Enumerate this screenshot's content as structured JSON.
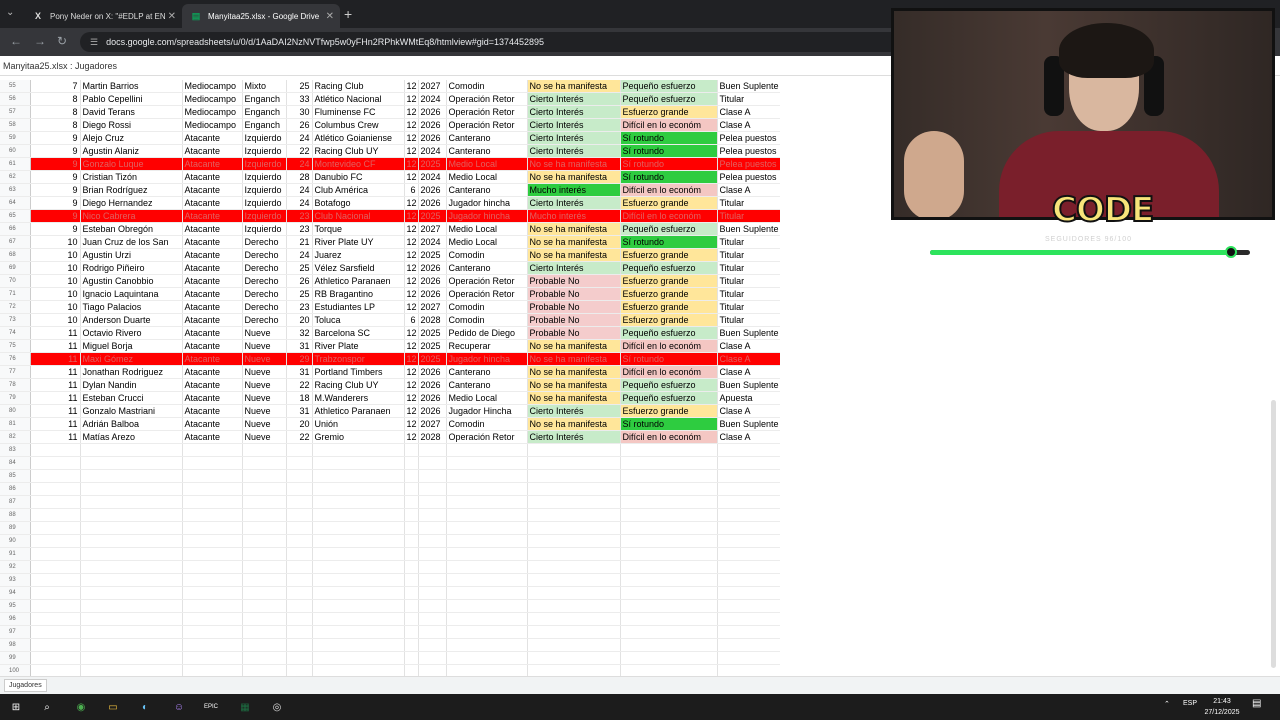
{
  "browser": {
    "tabs": [
      {
        "label": "Pony Neder on X: \"#EDLP at EN",
        "icon": "X"
      },
      {
        "label": "Manyitaa25.xlsx - Google Drive",
        "icon": "▤"
      }
    ],
    "url": "docs.google.com/spreadsheets/u/0/d/1AaDAI2NzNVTfwp5w0yFHn2RPhkWMtEq8/htmlview#gid=1374452895"
  },
  "sheet": {
    "title": "Manyitaa25.xlsx : Jugadores",
    "bottom_tab": "Jugadores",
    "rows": [
      {
        "rn": "55",
        "n": "7",
        "name": "Martin Barrios",
        "pos": "Mediocampo",
        "sub": "Mixto",
        "age": "25",
        "club": "Racing Club",
        "m": "12",
        "y": "2027",
        "type": "Comodin",
        "int": "No se ha manifesta",
        "eff": "Pequeño esfuerzo",
        "role": "Buen Suplente",
        "ic": "y",
        "ec": "gl",
        "rc": ""
      },
      {
        "rn": "56",
        "n": "8",
        "name": "Pablo Cepellini",
        "pos": "Mediocampo",
        "sub": "Enganch",
        "age": "33",
        "club": "Atlético Nacional",
        "m": "12",
        "y": "2024",
        "type": "Operación Retor",
        "int": "Cierto Interés",
        "eff": "Pequeño esfuerzo",
        "role": "Titular",
        "ic": "gl",
        "ec": "gl",
        "rc": ""
      },
      {
        "rn": "57",
        "n": "8",
        "name": "David Terans",
        "pos": "Mediocampo",
        "sub": "Enganch",
        "age": "30",
        "club": "Fluminense FC",
        "m": "12",
        "y": "2026",
        "type": "Operación Retor",
        "int": "Cierto Interés",
        "eff": "Esfuerzo grande",
        "role": "Clase A",
        "ic": "gl",
        "ec": "y",
        "rc": ""
      },
      {
        "rn": "58",
        "n": "8",
        "name": "Diego Rossi",
        "pos": "Mediocampo",
        "sub": "Enganch",
        "age": "26",
        "club": "Columbus Crew",
        "m": "12",
        "y": "2026",
        "type": "Operación Retor",
        "int": "Cierto Interés",
        "eff": "Difícil en lo económ",
        "role": "Clase A",
        "ic": "gl",
        "ec": "pk",
        "rc": ""
      },
      {
        "rn": "59",
        "n": "9",
        "name": "Alejo Cruz",
        "pos": "Atacante",
        "sub": "Izquierdo",
        "age": "24",
        "club": "Atlético Goianiense",
        "m": "12",
        "y": "2026",
        "type": "Canterano",
        "int": "Cierto Interés",
        "eff": "Sí rotundo",
        "role": "Pelea puestos",
        "ic": "gl",
        "ec": "gs",
        "rc": ""
      },
      {
        "rn": "60",
        "n": "9",
        "name": "Agustin Alaniz",
        "pos": "Atacante",
        "sub": "Izquierdo",
        "age": "22",
        "club": "Racing Club UY",
        "m": "12",
        "y": "2024",
        "type": "Canterano",
        "int": "Cierto Interés",
        "eff": "Sí rotundo",
        "role": "Pelea puestos",
        "ic": "gl",
        "ec": "gs",
        "rc": ""
      },
      {
        "rn": "61",
        "n": "9",
        "name": "Gonzalo Luque",
        "pos": "Atacante",
        "sub": "Izquierdo",
        "age": "24",
        "club": "Montevideo CF",
        "m": "12",
        "y": "2025",
        "type": "Medio Local",
        "int": "No se ha manifesta",
        "eff": "Sí rotundo",
        "role": "Pelea puestos",
        "ic": "y",
        "ec": "gs",
        "rc": "",
        "red": true
      },
      {
        "rn": "62",
        "n": "9",
        "name": "Cristian Tizón",
        "pos": "Atacante",
        "sub": "Izquierdo",
        "age": "28",
        "club": "Danubio FC",
        "m": "12",
        "y": "2024",
        "type": "Medio Local",
        "int": "No se ha manifesta",
        "eff": "Sí rotundo",
        "role": "Pelea puestos",
        "ic": "y",
        "ec": "gs",
        "rc": ""
      },
      {
        "rn": "63",
        "n": "9",
        "name": "Brian Rodríguez",
        "pos": "Atacante",
        "sub": "Izquierdo",
        "age": "24",
        "club": "Club América",
        "m": "6",
        "y": "2026",
        "type": "Canterano",
        "int": "Mucho interés",
        "eff": "Difícil en lo económ",
        "role": "Clase A",
        "ic": "gs",
        "ec": "pk",
        "rc": ""
      },
      {
        "rn": "64",
        "n": "9",
        "name": "Diego Hernandez",
        "pos": "Atacante",
        "sub": "Izquierdo",
        "age": "24",
        "club": "Botafogo",
        "m": "12",
        "y": "2026",
        "type": "Jugador hincha",
        "int": "Cierto Interés",
        "eff": "Esfuerzo grande",
        "role": "Titular",
        "ic": "gl",
        "ec": "y",
        "rc": ""
      },
      {
        "rn": "65",
        "n": "9",
        "name": "Nico Cabrera",
        "pos": "Atacante",
        "sub": "Izquierdo",
        "age": "23",
        "club": "Club Nacional",
        "m": "12",
        "y": "2025",
        "type": "Jugador hincha",
        "int": "Mucho interés",
        "eff": "Difícil en lo económ",
        "role": "Titular",
        "ic": "gs",
        "ec": "pk",
        "rc": "",
        "red": true
      },
      {
        "rn": "66",
        "n": "9",
        "name": "Esteban Obregón",
        "pos": "Atacante",
        "sub": "Izquierdo",
        "age": "23",
        "club": "Torque",
        "m": "12",
        "y": "2027",
        "type": "Medio Local",
        "int": "No se ha manifesta",
        "eff": "Pequeño esfuerzo",
        "role": "Buen Suplente",
        "ic": "y",
        "ec": "gl",
        "rc": ""
      },
      {
        "rn": "67",
        "n": "10",
        "name": "Juan Cruz de los San",
        "pos": "Atacante",
        "sub": "Derecho",
        "age": "21",
        "club": "River Plate UY",
        "m": "12",
        "y": "2024",
        "type": "Medio Local",
        "int": "No se ha manifesta",
        "eff": "Sí rotundo",
        "role": "Titular",
        "ic": "y",
        "ec": "gs",
        "rc": ""
      },
      {
        "rn": "68",
        "n": "10",
        "name": "Agustin Urzi",
        "pos": "Atacante",
        "sub": "Derecho",
        "age": "24",
        "club": "Juarez",
        "m": "12",
        "y": "2025",
        "type": "Comodin",
        "int": "No se ha manifesta",
        "eff": "Esfuerzo grande",
        "role": "Titular",
        "ic": "y",
        "ec": "y",
        "rc": ""
      },
      {
        "rn": "69",
        "n": "10",
        "name": "Rodrigo Piñeiro",
        "pos": "Atacante",
        "sub": "Derecho",
        "age": "25",
        "club": "Vélez Sarsfield",
        "m": "12",
        "y": "2026",
        "type": "Canterano",
        "int": "Cierto Interés",
        "eff": "Pequeño esfuerzo",
        "role": "Titular",
        "ic": "gl",
        "ec": "gl",
        "rc": ""
      },
      {
        "rn": "70",
        "n": "10",
        "name": "Agustin Canobbio",
        "pos": "Atacante",
        "sub": "Derecho",
        "age": "26",
        "club": "Athletico Paranaen",
        "m": "12",
        "y": "2026",
        "type": "Operación Retor",
        "int": "Probable No",
        "eff": "Esfuerzo grande",
        "role": "Titular",
        "ic": "rp",
        "ec": "y",
        "rc": ""
      },
      {
        "rn": "71",
        "n": "10",
        "name": "Ignacio Laquintana",
        "pos": "Atacante",
        "sub": "Derecho",
        "age": "25",
        "club": "RB Bragantino",
        "m": "12",
        "y": "2026",
        "type": "Operación Retor",
        "int": "Probable No",
        "eff": "Esfuerzo grande",
        "role": "Titular",
        "ic": "rp",
        "ec": "y",
        "rc": ""
      },
      {
        "rn": "72",
        "n": "10",
        "name": "Tiago Palacios",
        "pos": "Atacante",
        "sub": "Derecho",
        "age": "23",
        "club": "Estudiantes LP",
        "m": "12",
        "y": "2027",
        "type": "Comodin",
        "int": "Probable No",
        "eff": "Esfuerzo grande",
        "role": "Titular",
        "ic": "rp",
        "ec": "y",
        "rc": ""
      },
      {
        "rn": "73",
        "n": "10",
        "name": "Anderson Duarte",
        "pos": "Atacante",
        "sub": "Derecho",
        "age": "20",
        "club": "Toluca",
        "m": "6",
        "y": "2028",
        "type": "Comodin",
        "int": "Probable No",
        "eff": "Esfuerzo grande",
        "role": "Titular",
        "ic": "rp",
        "ec": "y",
        "rc": ""
      },
      {
        "rn": "74",
        "n": "11",
        "name": "Octavio Rivero",
        "pos": "Atacante",
        "sub": "Nueve",
        "age": "32",
        "club": "Barcelona SC",
        "m": "12",
        "y": "2025",
        "type": "Pedido de Diego",
        "int": "Probable No",
        "eff": "Pequeño esfuerzo",
        "role": "Buen Suplente",
        "ic": "rp",
        "ec": "gl",
        "rc": ""
      },
      {
        "rn": "75",
        "n": "11",
        "name": "Miguel Borja",
        "pos": "Atacante",
        "sub": "Nueve",
        "age": "31",
        "club": "River Plate",
        "m": "12",
        "y": "2025",
        "type": "Recuperar",
        "int": "No se ha manifesta",
        "eff": "Difícil en lo económ",
        "role": "Clase A",
        "ic": "y",
        "ec": "pk",
        "rc": ""
      },
      {
        "rn": "76",
        "n": "11",
        "name": "Maxi Gómez",
        "pos": "Atacante",
        "sub": "Nueve",
        "age": "29",
        "club": "Trabzonspor",
        "m": "12",
        "y": "2025",
        "type": "Jugador hincha",
        "int": "No se ha manifesta",
        "eff": "Sí rotundo",
        "role": "Clase A",
        "ic": "y",
        "ec": "gs",
        "rc": "",
        "red": true
      },
      {
        "rn": "77",
        "n": "11",
        "name": "Jonathan Rodriguez",
        "pos": "Atacante",
        "sub": "Nueve",
        "age": "31",
        "club": "Portland Timbers",
        "m": "12",
        "y": "2026",
        "type": "Canterano",
        "int": "No se ha manifesta",
        "eff": "Difícil en lo económ",
        "role": "Clase A",
        "ic": "y",
        "ec": "pk",
        "rc": ""
      },
      {
        "rn": "78",
        "n": "11",
        "name": "Dylan Nandin",
        "pos": "Atacante",
        "sub": "Nueve",
        "age": "22",
        "club": "Racing Club UY",
        "m": "12",
        "y": "2026",
        "type": "Canterano",
        "int": "No se ha manifesta",
        "eff": "Pequeño esfuerzo",
        "role": "Buen Suplente",
        "ic": "y",
        "ec": "gl",
        "rc": ""
      },
      {
        "rn": "79",
        "n": "11",
        "name": "Esteban Crucci",
        "pos": "Atacante",
        "sub": "Nueve",
        "age": "18",
        "club": "M.Wanderers",
        "m": "12",
        "y": "2026",
        "type": "Medio Local",
        "int": "No se ha manifesta",
        "eff": "Pequeño esfuerzo",
        "role": "Apuesta",
        "ic": "y",
        "ec": "gl",
        "rc": ""
      },
      {
        "rn": "80",
        "n": "11",
        "name": "Gonzalo Mastriani",
        "pos": "Atacante",
        "sub": "Nueve",
        "age": "31",
        "club": "Athletico Paranaen",
        "m": "12",
        "y": "2026",
        "type": "Jugador Hincha",
        "int": "Cierto Interés",
        "eff": "Esfuerzo grande",
        "role": "Clase A",
        "ic": "gl",
        "ec": "y",
        "rc": ""
      },
      {
        "rn": "81",
        "n": "11",
        "name": "Adrián Balboa",
        "pos": "Atacante",
        "sub": "Nueve",
        "age": "20",
        "club": "Unión",
        "m": "12",
        "y": "2027",
        "type": "Comodin",
        "int": "No se ha manifesta",
        "eff": "Sí rotundo",
        "role": "Buen Suplente",
        "ic": "y",
        "ec": "gs",
        "rc": ""
      },
      {
        "rn": "82",
        "n": "11",
        "name": "Matías Arezo",
        "pos": "Atacante",
        "sub": "Nueve",
        "age": "22",
        "club": "Gremio",
        "m": "12",
        "y": "2028",
        "type": "Operación Retor",
        "int": "Cierto Interés",
        "eff": "Difícil en lo económ",
        "role": "Clase A",
        "ic": "gl",
        "ec": "pk",
        "rc": ""
      }
    ],
    "empty_rows": [
      "83",
      "84",
      "85",
      "86",
      "87",
      "88",
      "89",
      "90",
      "91",
      "92",
      "93",
      "94",
      "95",
      "96",
      "97",
      "98",
      "99",
      "100",
      "101"
    ]
  },
  "overlay": {
    "logo": "CODE",
    "followers": "SEGUIDORES 96/100",
    "progress": 0.96
  },
  "taskbar": {
    "lang": "ESP",
    "time": "21:43",
    "date": "27/12/2025"
  }
}
